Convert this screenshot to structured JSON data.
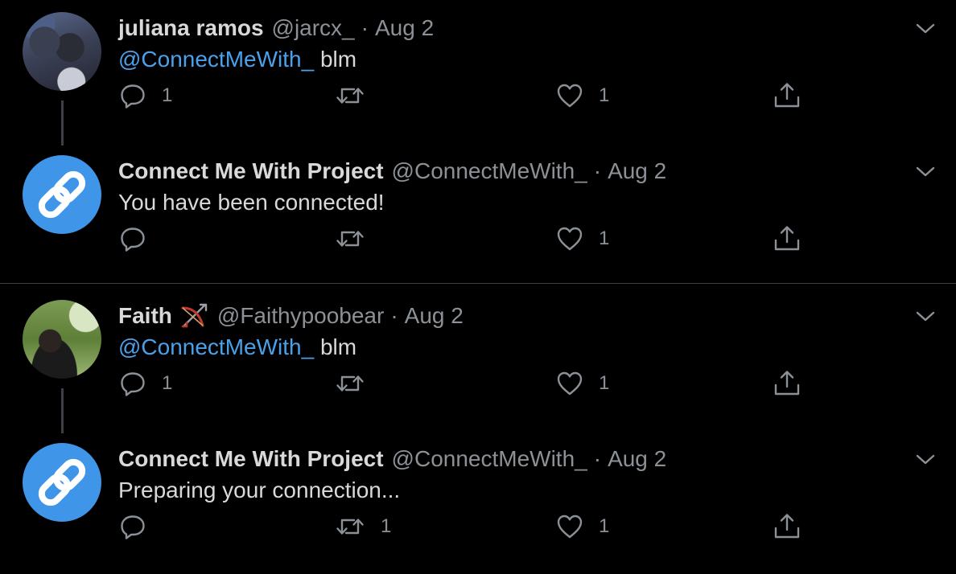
{
  "colors": {
    "background": "#000000",
    "text": "#d9d9d9",
    "muted": "#8b9197",
    "link": "#4aa1eb",
    "logo_blue": "#3f96e8",
    "divider": "#3d4146"
  },
  "icons": {
    "reply": "reply-icon",
    "retweet": "retweet-icon",
    "like": "heart-icon",
    "share": "share-icon",
    "more": "chevron-down-icon",
    "logo": "link-chain-icon",
    "emoji": "bow-and-arrow-emoji"
  },
  "tweets": [
    {
      "display_name": "juliana ramos",
      "handle": "@jarcx_",
      "separator": "·",
      "time": "Aug 2",
      "mention": "@ConnectMeWith_",
      "text": " blm",
      "reply_count": "1",
      "retweet_count": "",
      "like_count": "1"
    },
    {
      "display_name": "Connect Me With Project",
      "handle": "@ConnectMeWith_",
      "separator": "·",
      "time": "Aug 2",
      "text": "You have been connected!",
      "reply_count": "",
      "retweet_count": "",
      "like_count": "1"
    },
    {
      "display_name": "Faith",
      "handle": "@Faithypoobear",
      "separator": "·",
      "time": "Aug 2",
      "mention": "@ConnectMeWith_",
      "text": " blm",
      "reply_count": "1",
      "retweet_count": "",
      "like_count": "1"
    },
    {
      "display_name": "Connect Me With Project",
      "handle": "@ConnectMeWith_",
      "separator": "·",
      "time": "Aug 2",
      "text": "Preparing your connection...",
      "reply_count": "",
      "retweet_count": "1",
      "like_count": "1"
    }
  ]
}
